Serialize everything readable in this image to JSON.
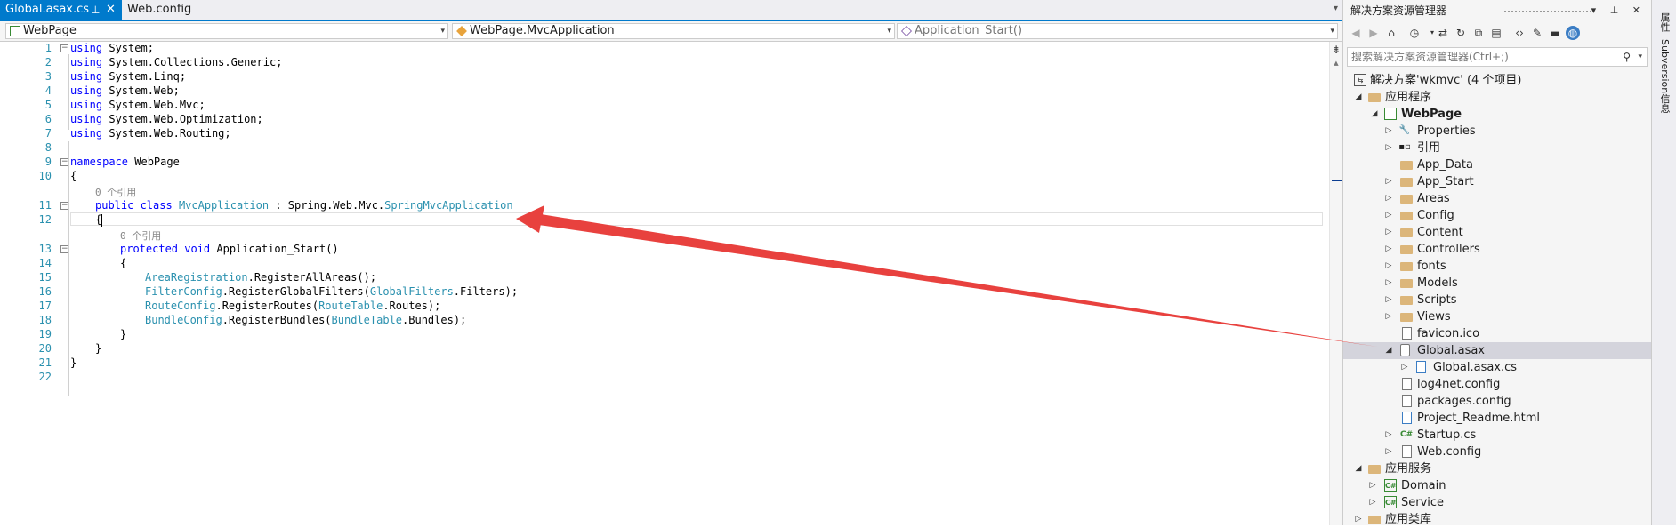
{
  "tabs": {
    "active": {
      "label": "Global.asax.cs",
      "pin_icon": "⊥",
      "close_icon": "✕"
    },
    "second": {
      "label": "Web.config"
    }
  },
  "nav": {
    "project": "WebPage",
    "class": "WebPage.MvcApplication",
    "member": "Application_Start()"
  },
  "code": {
    "line_numbers": [
      "1",
      "2",
      "3",
      "4",
      "5",
      "6",
      "7",
      "8",
      "9",
      "10",
      "11",
      "12",
      "13",
      "14",
      "15",
      "16",
      "17",
      "18",
      "19",
      "20",
      "21",
      "22"
    ],
    "lines": [
      {
        "kw": "using",
        "rest": " System;"
      },
      {
        "kw": "using",
        "rest": " System.Collections.Generic;"
      },
      {
        "kw": "using",
        "rest": " System.Linq;"
      },
      {
        "kw": "using",
        "rest": " System.Web;"
      },
      {
        "kw": "using",
        "rest": " System.Web.Mvc;"
      },
      {
        "kw": "using",
        "rest": " System.Web.Optimization;"
      },
      {
        "kw": "using",
        "rest": " System.Web.Routing;"
      }
    ],
    "namespace_kw": "namespace",
    "namespace_name": " WebPage",
    "brace_open": "{",
    "brace_close": "}",
    "ref_count_1": "0 个引用",
    "class_kw": "public class",
    "class_name": "MvcApplication",
    "class_base_prefix": " : Spring.Web.Mvc.",
    "class_base_type": "SpringMvcApplication",
    "ref_count_2": "0 个引用",
    "method_kw": "protected void",
    "method_name": " Application_Start()",
    "body": [
      {
        "type": "AreaRegistration",
        "mid": ".RegisterAllAreas();",
        "type2": "",
        "end": ""
      },
      {
        "type": "FilterConfig",
        "mid": ".RegisterGlobalFilters(",
        "type2": "GlobalFilters",
        "end": ".Filters);"
      },
      {
        "type": "RouteConfig",
        "mid": ".RegisterRoutes(",
        "type2": "RouteTable",
        "end": ".Routes);"
      },
      {
        "type": "BundleConfig",
        "mid": ".RegisterBundles(",
        "type2": "BundleTable",
        "end": ".Bundles);"
      }
    ]
  },
  "solution_explorer": {
    "title": "解决方案资源管理器",
    "title_buttons": "▾ ⊥ ✕",
    "search_placeholder": "搜索解决方案资源管理器(Ctrl+;)",
    "solution_label": "解决方案'wkmvc' (4 个项目)",
    "nodes": [
      {
        "label": "应用程序",
        "icon": "folder-icon"
      },
      {
        "label": "WebPage",
        "icon": "project-icon"
      },
      {
        "label": "Properties",
        "icon": "wrench-icon"
      },
      {
        "label": "引用",
        "icon": "references-icon"
      },
      {
        "label": "App_Data",
        "icon": "folder-icon"
      },
      {
        "label": "App_Start",
        "icon": "folder-icon"
      },
      {
        "label": "Areas",
        "icon": "folder-icon"
      },
      {
        "label": "Config",
        "icon": "folder-icon"
      },
      {
        "label": "Content",
        "icon": "folder-icon"
      },
      {
        "label": "Controllers",
        "icon": "folder-icon"
      },
      {
        "label": "fonts",
        "icon": "folder-icon"
      },
      {
        "label": "Models",
        "icon": "folder-icon"
      },
      {
        "label": "Scripts",
        "icon": "folder-icon"
      },
      {
        "label": "Views",
        "icon": "folder-icon"
      },
      {
        "label": "favicon.ico",
        "icon": "file-icon"
      },
      {
        "label": "Global.asax",
        "icon": "global-asax-icon"
      },
      {
        "label": "Global.asax.cs",
        "icon": "csharp-file-icon"
      },
      {
        "label": "log4net.config",
        "icon": "config-file-icon"
      },
      {
        "label": "packages.config",
        "icon": "config-file-icon"
      },
      {
        "label": "Project_Readme.html",
        "icon": "html-file-icon"
      },
      {
        "label": "Startup.cs",
        "icon": "csharp-icon"
      },
      {
        "label": "Web.config",
        "icon": "config-file-icon"
      },
      {
        "label": "应用服务",
        "icon": "folder-icon"
      },
      {
        "label": "Domain",
        "icon": "csharp-project-icon"
      },
      {
        "label": "Service",
        "icon": "csharp-project-icon"
      },
      {
        "label": "应用类库",
        "icon": "folder-icon"
      }
    ]
  },
  "side_tabs": {
    "properties": "属性",
    "subversion": "Subversion信息"
  },
  "colors": {
    "accent": "#007acc",
    "keyword": "#0000ff",
    "type": "#2b91af",
    "annotation_arrow": "#e8413e",
    "selection": "#d4d4dc"
  }
}
